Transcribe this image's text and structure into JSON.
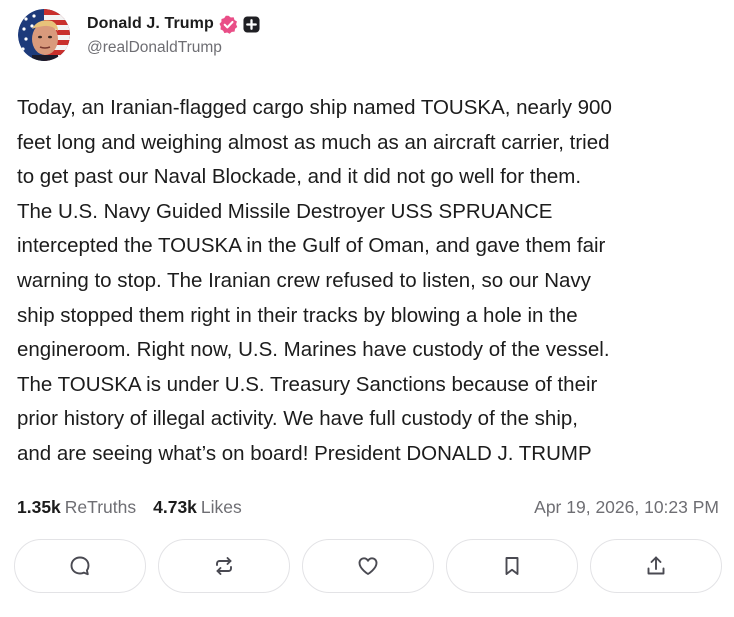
{
  "author": {
    "display_name": "Donald J. Trump",
    "handle": "@realDonaldTrump"
  },
  "post": {
    "lines": [
      "Today, an Iranian-flagged cargo ship named TOUSKA, nearly 900",
      "feet long and weighing almost as much as an aircraft carrier, tried",
      "to get past our Naval Blockade, and it did not go well for them.",
      "The U.S. Navy Guided Missile Destroyer USS SPRUANCE",
      "intercepted the TOUSKA in the Gulf of Oman, and gave them fair",
      "warning to stop. The Iranian crew refused to listen, so our Navy",
      "ship stopped them right in their tracks by blowing a hole in the",
      "engineroom. Right now, U.S. Marines have custody of the vessel.",
      "The TOUSKA is under U.S. Treasury Sanctions because of their",
      "prior history of illegal activity. We have full custody of the ship,",
      "and are seeing what’s on board! President DONALD J. TRUMP"
    ]
  },
  "stats": {
    "retruths_count": "1.35k",
    "retruths_label": "ReTruths",
    "likes_count": "4.73k",
    "likes_label": "Likes",
    "timestamp": "Apr 19, 2026, 10:23 PM"
  },
  "actions": [
    {
      "icon": "reply-icon"
    },
    {
      "icon": "retruth-icon"
    },
    {
      "icon": "like-heart-icon"
    },
    {
      "icon": "bookmark-icon"
    },
    {
      "icon": "share-icon"
    }
  ],
  "colors": {
    "text": "#1c1c1c",
    "muted": "#6e6e73",
    "verified_badge": "#e94e87",
    "button_border": "#e3e3e6"
  }
}
